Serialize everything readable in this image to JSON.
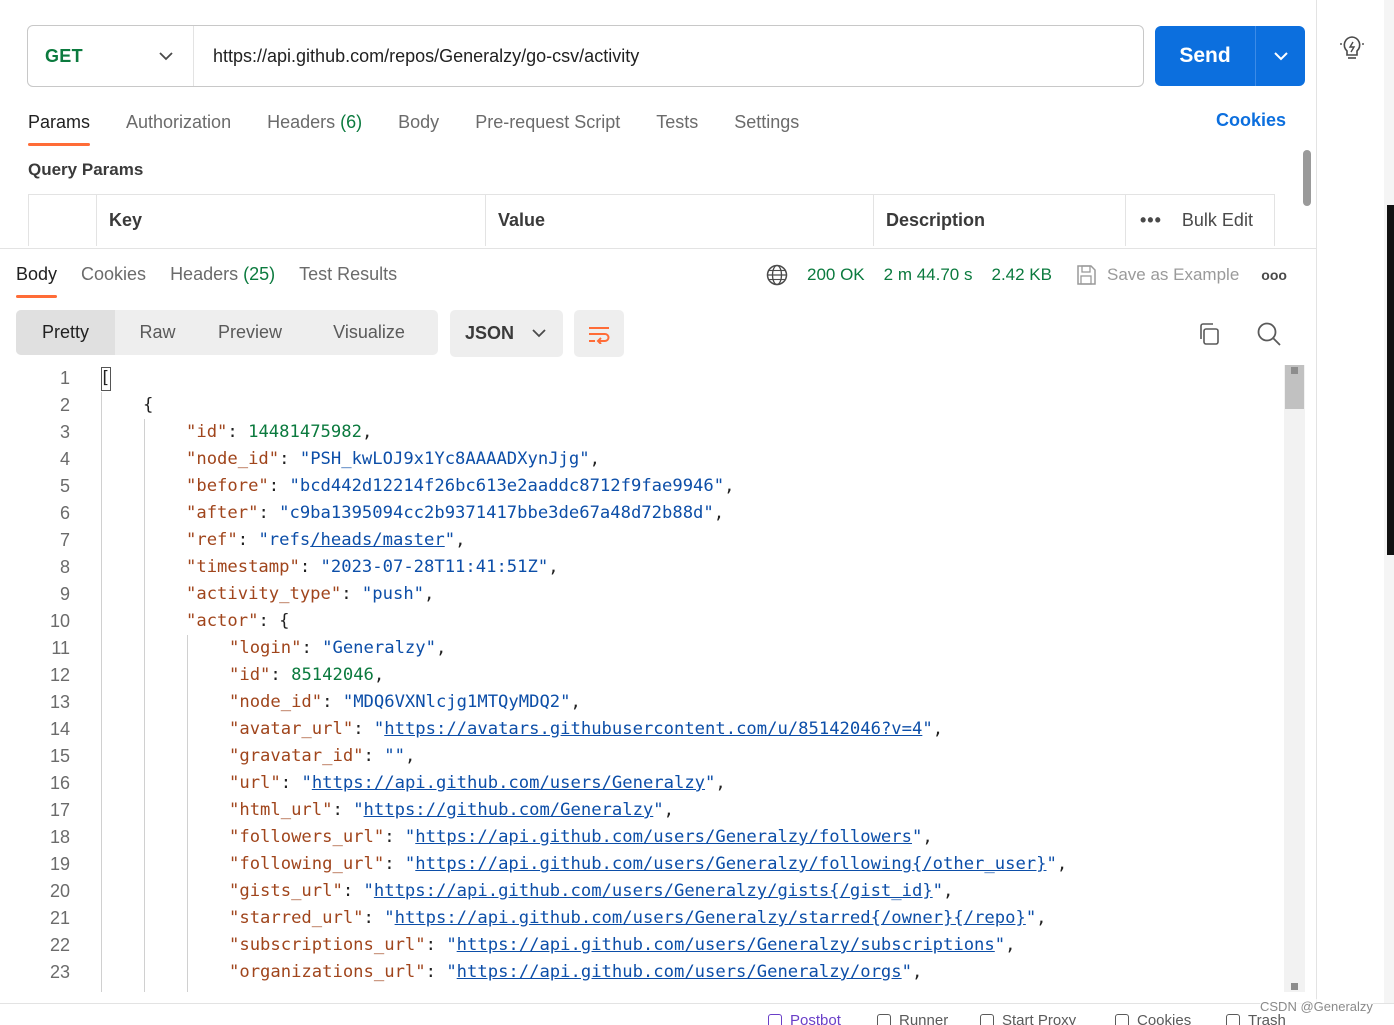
{
  "request": {
    "method": "GET",
    "url": "https://api.github.com/repos/Generalzy/go-csv/activity",
    "send_label": "Send"
  },
  "request_tabs": [
    {
      "label": "Params",
      "count": ""
    },
    {
      "label": "Authorization",
      "count": ""
    },
    {
      "label": "Headers",
      "count": "(6)"
    },
    {
      "label": "Body",
      "count": ""
    },
    {
      "label": "Pre-request Script",
      "count": ""
    },
    {
      "label": "Tests",
      "count": ""
    },
    {
      "label": "Settings",
      "count": ""
    }
  ],
  "cookies_link": "Cookies",
  "query_params": {
    "title": "Query Params",
    "columns": [
      "Key",
      "Value",
      "Description"
    ],
    "bulk_edit": "Bulk Edit"
  },
  "response": {
    "tabs": [
      {
        "label": "Body",
        "count": ""
      },
      {
        "label": "Cookies",
        "count": ""
      },
      {
        "label": "Headers",
        "count": "(25)"
      },
      {
        "label": "Test Results",
        "count": ""
      }
    ],
    "status": "200 OK",
    "time": "2 m 44.70 s",
    "size": "2.42 KB",
    "save_example": "Save as Example",
    "view_modes": [
      "Pretty",
      "Raw",
      "Preview",
      "Visualize"
    ],
    "format": "JSON"
  },
  "code_lines": [
    {
      "n": "1",
      "indent": 0,
      "parts": [
        [
          "p",
          "["
        ]
      ]
    },
    {
      "n": "2",
      "indent": 1,
      "parts": [
        [
          "p",
          "{"
        ]
      ]
    },
    {
      "n": "3",
      "indent": 2,
      "parts": [
        [
          "k",
          "\"id\""
        ],
        [
          "p",
          ": "
        ],
        [
          "n",
          "14481475982"
        ],
        [
          "p",
          ","
        ]
      ]
    },
    {
      "n": "4",
      "indent": 2,
      "parts": [
        [
          "k",
          "\"node_id\""
        ],
        [
          "p",
          ": "
        ],
        [
          "s",
          "\"PSH_kwLOJ9x1Yc8AAAADXynJjg\""
        ],
        [
          "p",
          ","
        ]
      ]
    },
    {
      "n": "5",
      "indent": 2,
      "parts": [
        [
          "k",
          "\"before\""
        ],
        [
          "p",
          ": "
        ],
        [
          "s",
          "\"bcd442d12214f26bc613e2aaddc8712f9fae9946\""
        ],
        [
          "p",
          ","
        ]
      ]
    },
    {
      "n": "6",
      "indent": 2,
      "parts": [
        [
          "k",
          "\"after\""
        ],
        [
          "p",
          ": "
        ],
        [
          "s",
          "\"c9ba1395094cc2b9371417bbe3de67a48d72b88d\""
        ],
        [
          "p",
          ","
        ]
      ]
    },
    {
      "n": "7",
      "indent": 2,
      "parts": [
        [
          "k",
          "\"ref\""
        ],
        [
          "p",
          ": "
        ],
        [
          "s",
          "\"refs"
        ],
        [
          "u",
          "/heads/master"
        ],
        [
          "s",
          "\""
        ],
        [
          "p",
          ","
        ]
      ]
    },
    {
      "n": "8",
      "indent": 2,
      "parts": [
        [
          "k",
          "\"timestamp\""
        ],
        [
          "p",
          ": "
        ],
        [
          "s",
          "\"2023-07-28T11:41:51Z\""
        ],
        [
          "p",
          ","
        ]
      ]
    },
    {
      "n": "9",
      "indent": 2,
      "parts": [
        [
          "k",
          "\"activity_type\""
        ],
        [
          "p",
          ": "
        ],
        [
          "s",
          "\"push\""
        ],
        [
          "p",
          ","
        ]
      ]
    },
    {
      "n": "10",
      "indent": 2,
      "parts": [
        [
          "k",
          "\"actor\""
        ],
        [
          "p",
          ": {"
        ]
      ]
    },
    {
      "n": "11",
      "indent": 3,
      "parts": [
        [
          "k",
          "\"login\""
        ],
        [
          "p",
          ": "
        ],
        [
          "s",
          "\"Generalzy\""
        ],
        [
          "p",
          ","
        ]
      ]
    },
    {
      "n": "12",
      "indent": 3,
      "parts": [
        [
          "k",
          "\"id\""
        ],
        [
          "p",
          ": "
        ],
        [
          "n",
          "85142046"
        ],
        [
          "p",
          ","
        ]
      ]
    },
    {
      "n": "13",
      "indent": 3,
      "parts": [
        [
          "k",
          "\"node_id\""
        ],
        [
          "p",
          ": "
        ],
        [
          "s",
          "\"MDQ6VXNlcjg1MTQyMDQ2\""
        ],
        [
          "p",
          ","
        ]
      ]
    },
    {
      "n": "14",
      "indent": 3,
      "parts": [
        [
          "k",
          "\"avatar_url\""
        ],
        [
          "p",
          ": "
        ],
        [
          "s",
          "\""
        ],
        [
          "u",
          "https://avatars.githubusercontent.com/u/85142046?v=4"
        ],
        [
          "s",
          "\""
        ],
        [
          "p",
          ","
        ]
      ]
    },
    {
      "n": "15",
      "indent": 3,
      "parts": [
        [
          "k",
          "\"gravatar_id\""
        ],
        [
          "p",
          ": "
        ],
        [
          "s",
          "\"\""
        ],
        [
          "p",
          ","
        ]
      ]
    },
    {
      "n": "16",
      "indent": 3,
      "parts": [
        [
          "k",
          "\"url\""
        ],
        [
          "p",
          ": "
        ],
        [
          "s",
          "\""
        ],
        [
          "u",
          "https://api.github.com/users/Generalzy"
        ],
        [
          "s",
          "\""
        ],
        [
          "p",
          ","
        ]
      ]
    },
    {
      "n": "17",
      "indent": 3,
      "parts": [
        [
          "k",
          "\"html_url\""
        ],
        [
          "p",
          ": "
        ],
        [
          "s",
          "\""
        ],
        [
          "u",
          "https://github.com/Generalzy"
        ],
        [
          "s",
          "\""
        ],
        [
          "p",
          ","
        ]
      ]
    },
    {
      "n": "18",
      "indent": 3,
      "parts": [
        [
          "k",
          "\"followers_url\""
        ],
        [
          "p",
          ": "
        ],
        [
          "s",
          "\""
        ],
        [
          "u",
          "https://api.github.com/users/Generalzy/followers"
        ],
        [
          "s",
          "\""
        ],
        [
          "p",
          ","
        ]
      ]
    },
    {
      "n": "19",
      "indent": 3,
      "parts": [
        [
          "k",
          "\"following_url\""
        ],
        [
          "p",
          ": "
        ],
        [
          "s",
          "\""
        ],
        [
          "u",
          "https://api.github.com/users/Generalzy/following{/other_user}"
        ],
        [
          "s",
          "\""
        ],
        [
          "p",
          ","
        ]
      ]
    },
    {
      "n": "20",
      "indent": 3,
      "parts": [
        [
          "k",
          "\"gists_url\""
        ],
        [
          "p",
          ": "
        ],
        [
          "s",
          "\""
        ],
        [
          "u",
          "https://api.github.com/users/Generalzy/gists{/gist_id}"
        ],
        [
          "s",
          "\""
        ],
        [
          "p",
          ","
        ]
      ]
    },
    {
      "n": "21",
      "indent": 3,
      "parts": [
        [
          "k",
          "\"starred_url\""
        ],
        [
          "p",
          ": "
        ],
        [
          "s",
          "\""
        ],
        [
          "u",
          "https://api.github.com/users/Generalzy/starred{/owner}{/repo}"
        ],
        [
          "s",
          "\""
        ],
        [
          "p",
          ","
        ]
      ]
    },
    {
      "n": "22",
      "indent": 3,
      "parts": [
        [
          "k",
          "\"subscriptions_url\""
        ],
        [
          "p",
          ": "
        ],
        [
          "s",
          "\""
        ],
        [
          "u",
          "https://api.github.com/users/Generalzy/subscriptions"
        ],
        [
          "s",
          "\""
        ],
        [
          "p",
          ","
        ]
      ]
    },
    {
      "n": "23",
      "indent": 3,
      "parts": [
        [
          "k",
          "\"organizations_url\""
        ],
        [
          "p",
          ": "
        ],
        [
          "s",
          "\""
        ],
        [
          "u",
          "https://api.github.com/users/Generalzy/orgs"
        ],
        [
          "s",
          "\""
        ],
        [
          "p",
          ","
        ]
      ]
    }
  ],
  "bottom_bar": [
    "Postbot",
    "Runner",
    "Start Proxy",
    "Cookies",
    "Trash"
  ],
  "watermark": "CSDN @Generalzy",
  "colors": {
    "accent": "#ff6c37",
    "send": "#0c6fde",
    "success": "#0b7a3e"
  }
}
